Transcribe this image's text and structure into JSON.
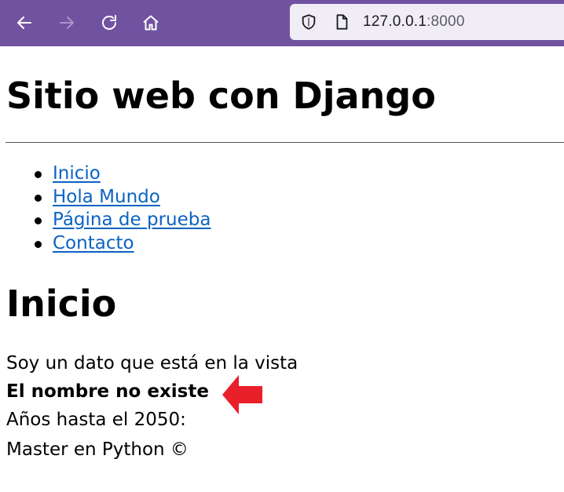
{
  "browser": {
    "url_host": "127.0.0.1",
    "url_port": ":8000",
    "icons": [
      "back-icon",
      "forward-icon",
      "reload-icon",
      "home-icon",
      "shield-icon",
      "page-icon"
    ],
    "theme_color": "#7152a0"
  },
  "page": {
    "title": "Sitio web con Django",
    "nav": [
      "Inicio",
      "Hola Mundo",
      "Página de prueba",
      "Contacto"
    ],
    "section_title": "Inicio",
    "data_line": "Soy un dato que está en la vista",
    "name_message": "El nombre no existe",
    "years_line": "Años hasta el 2050:",
    "footer": "Master en Python ©",
    "link_color": "#0b63c3"
  },
  "annotation": {
    "icon": "red-arrow-icon",
    "color": "#e8202a"
  }
}
